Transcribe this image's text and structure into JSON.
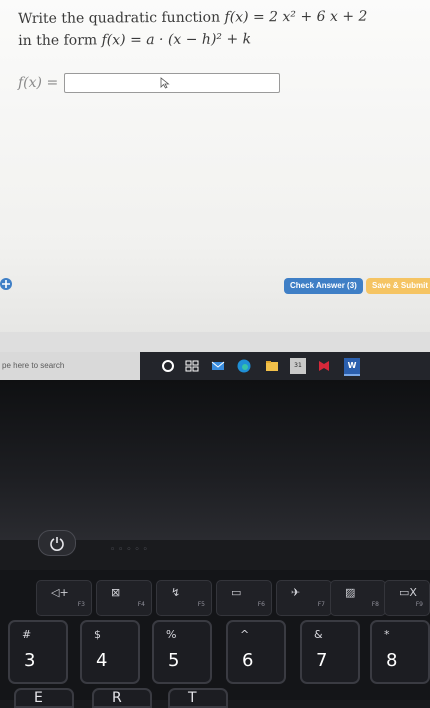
{
  "question": {
    "line1_prefix": "Write the quadratic function",
    "line1_math": "f(x) = 2 x² + 6 x + 2",
    "line2_prefix": "in the form",
    "line2_math": "f(x) = a · (x − h)² + k"
  },
  "answer": {
    "label": "f(x) =",
    "value": ""
  },
  "buttons": {
    "check_answer": "Check Answer (3)",
    "save_submit": "Save & Submit"
  },
  "taskbar": {
    "search_text": "pe here to search",
    "calendar_day": "31",
    "word_letter": "W"
  },
  "function_keys": [
    {
      "symbol": "◁+",
      "fn": "F3"
    },
    {
      "symbol": "⊠",
      "fn": "F4"
    },
    {
      "symbol": "↯",
      "fn": "F5"
    },
    {
      "symbol": "▭",
      "fn": "F6"
    },
    {
      "symbol": "✈",
      "fn": "F7"
    },
    {
      "symbol": "▨",
      "fn": "F8"
    },
    {
      "symbol": "▭X",
      "fn": "F9"
    }
  ],
  "number_keys": [
    {
      "top": "#",
      "bottom": "3"
    },
    {
      "top": "$",
      "bottom": "4"
    },
    {
      "top": "%",
      "bottom": "5"
    },
    {
      "top": "^",
      "bottom": "6"
    },
    {
      "top": "&",
      "bottom": "7"
    },
    {
      "top": "*",
      "bottom": "8"
    }
  ],
  "letter_keys": [
    "E",
    "R",
    "T"
  ],
  "colors": {
    "check_button": "#3f7fc6",
    "save_button": "#f5c463"
  }
}
